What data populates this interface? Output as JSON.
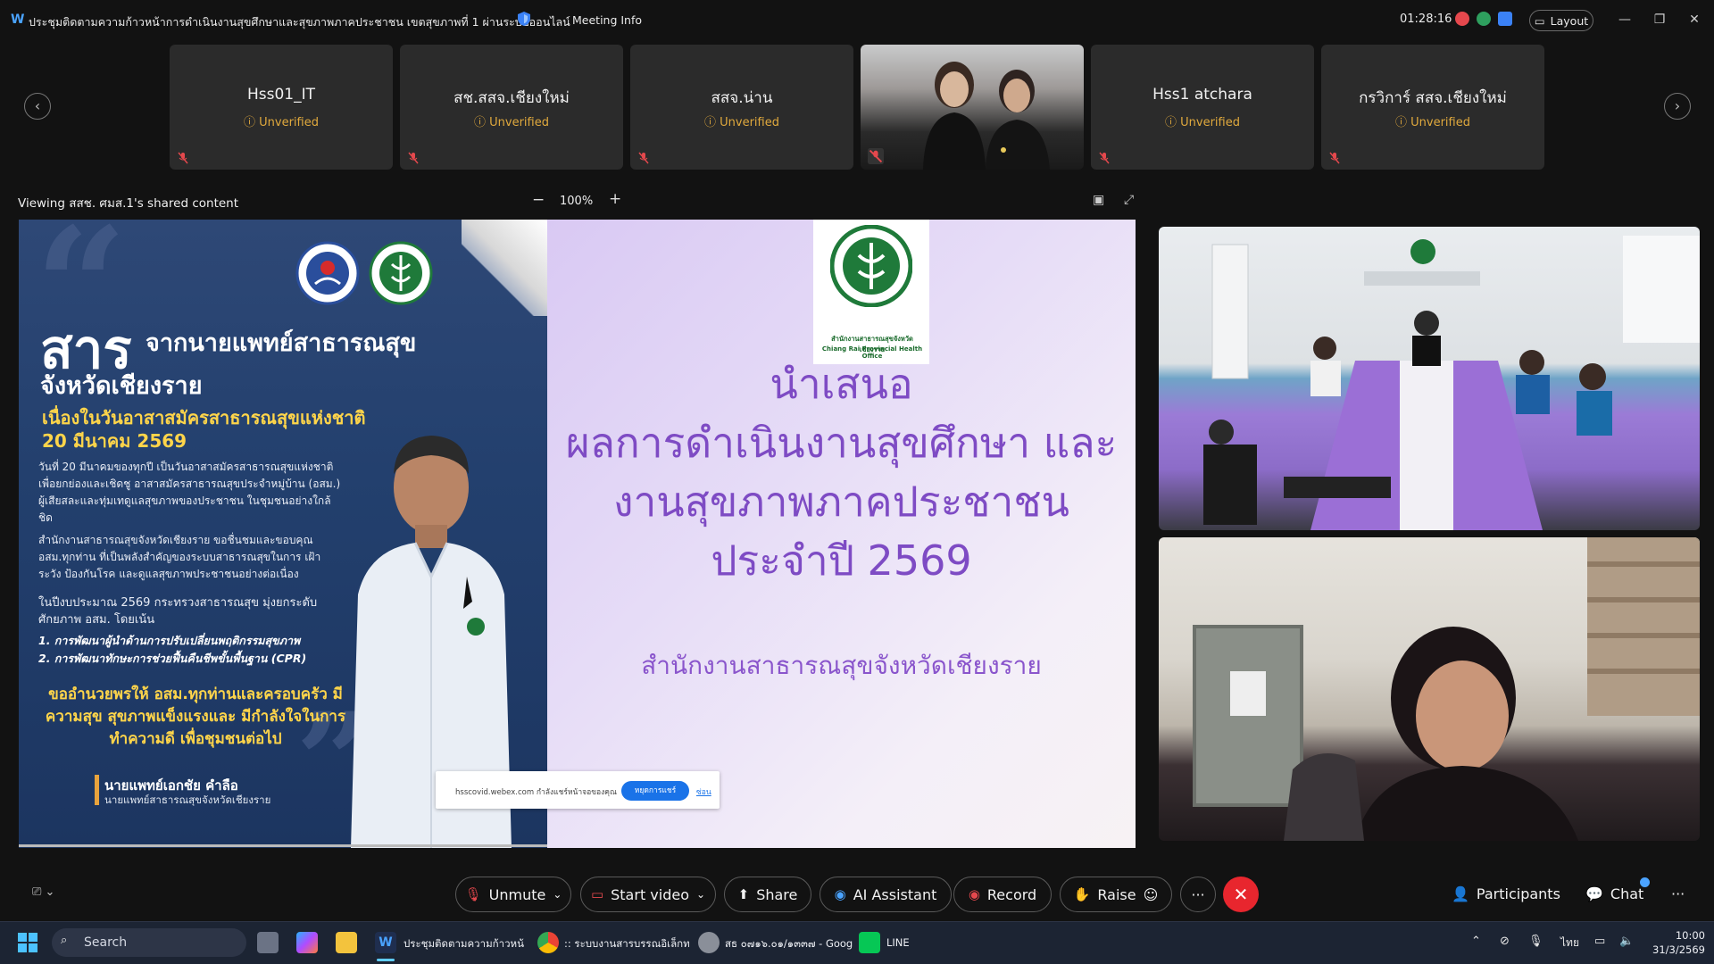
{
  "window": {
    "title": "ประชุมติดตามความก้าวหน้าการดำเนินงานสุขศึกษาและสุขภาพภาคประชาชน เขตสุขภาพที่ 1 ผ่านระบบออนไลน์",
    "meeting_info": "Meeting Info",
    "timer": "01:28:16",
    "layout_label": "Layout"
  },
  "participants_strip": [
    {
      "name": "Hss01_IT",
      "status": "Unverified",
      "type": "avatar"
    },
    {
      "name": "สช.สสจ.เชียงใหม่",
      "status": "Unverified",
      "type": "avatar"
    },
    {
      "name": "สสจ.น่าน",
      "status": "Unverified",
      "type": "avatar"
    },
    {
      "name": "",
      "status": "",
      "type": "video"
    },
    {
      "name": "Hss1 atchara",
      "status": "Unverified",
      "type": "avatar"
    },
    {
      "name": "กรวิการ์ สสจ.เชียงใหม่",
      "status": "Unverified",
      "type": "avatar"
    }
  ],
  "share": {
    "viewing": "Viewing สสช. ศมส.1's shared content",
    "zoom_minus": "−",
    "zoom": "100%",
    "zoom_plus": "+"
  },
  "slide": {
    "left": {
      "big": "สาร",
      "line1": "จากนายแพทย์สาธารณสุข",
      "line2": "จังหวัดเชียงราย",
      "sub1": "เนื่องในวันอาสาสมัครสาธารณสุขแห่งชาติ",
      "sub2": "20 มีนาคม 2569",
      "para1": "วันที่ 20 มีนาคมของทุกปี เป็นวันอาสาสมัครสาธารณสุขแห่งชาติ เพื่อยกย่องและเชิดชู อาสาสมัครสาธารณสุขประจำหมู่บ้าน (อสม.) ผู้เสียสละและทุ่มเทดูแลสุขภาพของประชาชน ในชุมชนอย่างใกล้ชิด",
      "para2": "สำนักงานสาธารณสุขจังหวัดเชียงราย ขอชื่นชมและขอบคุณ อสม.ทุกท่าน ที่เป็นพลังสำคัญของระบบสาธารณสุขในการ เฝ้าระวัง ป้องกันโรค และดูแลสุขภาพประชาชนอย่างต่อเนื่อง",
      "para3": "ในปีงบประมาณ 2569 กระทรวงสาธารณสุข มุ่งยกระดับศักยภาพ อสม. โดยเน้น",
      "bold1": "1. การพัฒนาผู้นำด้านการปรับเปลี่ยนพฤติกรรมสุขภาพ",
      "bold2": "2. การพัฒนาทักษะการช่วยฟื้นคืนชีพขั้นพื้นฐาน (CPR)",
      "wish": "ขออำนวยพรให้ อสม.ทุกท่านและครอบครัว มีความสุข สุขภาพแข็งแรงและ มีกำลังใจในการทำความดี เพื่อชุมชนต่อไป",
      "sign_name": "นายแพทย์เอกชัย คำลือ",
      "sign_title": "นายแพทย์สาธารณสุขจังหวัดเชียงราย"
    },
    "right": {
      "l1": "นำเสนอ",
      "l2": "ผลการดำเนินงานสุขศึกษา และ",
      "l3": "งานสุขภาพภาคประชาชน",
      "l4": "ประจำปี 2569",
      "org": "สำนักงานสาธารณสุขจังหวัดเชียงราย",
      "moph_cap1": "สำนักงานสาธารณสุขจังหวัดเชียงราย",
      "moph_cap2": "Chiang Rai Provincial Health Office"
    },
    "notice": {
      "text": "hsscovid.webex.com กำลังแชร์หน้าจอของคุณ",
      "stop": "หยุดการแชร์",
      "hide": "ซ่อน"
    }
  },
  "controls": {
    "unmute": "Unmute",
    "start_video": "Start video",
    "share": "Share",
    "ai_assistant": "AI Assistant",
    "record": "Record",
    "raise": "Raise",
    "more": "···",
    "participants": "Participants",
    "chat": "Chat",
    "overflow": "···"
  },
  "taskbar": {
    "search": "Search",
    "apps": [
      {
        "label": "ประชุมติดตามความก้าวหน้",
        "icon": "webex-icon"
      },
      {
        "label": ":: ระบบงานสารบรรณอิเล็กท",
        "icon": "chrome-icon"
      },
      {
        "label": "สธ ๐๗๑๖.๐๑/๑๓๓๗ - Goog",
        "icon": "chrome-icon"
      },
      {
        "label": "LINE",
        "icon": "line-icon"
      }
    ],
    "lang": "ไทย",
    "time": "10:00",
    "date": "31/3/2569"
  },
  "colors": {
    "accent": "#4aa3ff",
    "unverified": "#e0a93d",
    "end_call": "#e8262e",
    "slide_purple": "#7e4bc4"
  }
}
